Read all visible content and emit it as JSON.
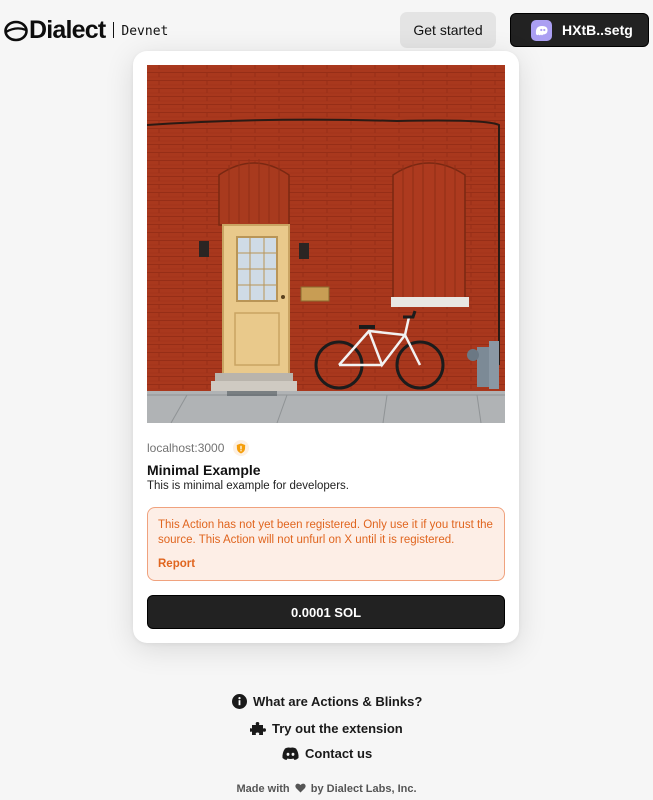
{
  "header": {
    "logo_text": "Dialect",
    "environment": "Devnet",
    "get_started_label": "Get started",
    "wallet_label": "HXtB..setg"
  },
  "action_card": {
    "host": "localhost:3000",
    "title": "Minimal Example",
    "description": "This is minimal example for developers.",
    "warning": {
      "line1": "This Action has not yet been registered. Only use it if you trust the",
      "line2": "source. This Action will not unfurl on X until it is registered.",
      "report_label": "Report"
    },
    "button_label": "0.0001 SOL"
  },
  "footer": {
    "links": [
      {
        "icon": "info-icon",
        "label": "What are Actions & Blinks?"
      },
      {
        "icon": "puzzle-icon",
        "label": "Try out the extension"
      },
      {
        "icon": "discord-icon",
        "label": "Contact us"
      }
    ],
    "made_with_prefix": "Made with",
    "made_with_suffix": "by Dialect Labs, Inc."
  },
  "colors": {
    "accent_dark": "#222222",
    "warning_text": "#e0651f",
    "warning_bg": "#fdeee6",
    "wallet_avatar": "#ab9ff2",
    "brick": "#b23a1f"
  }
}
